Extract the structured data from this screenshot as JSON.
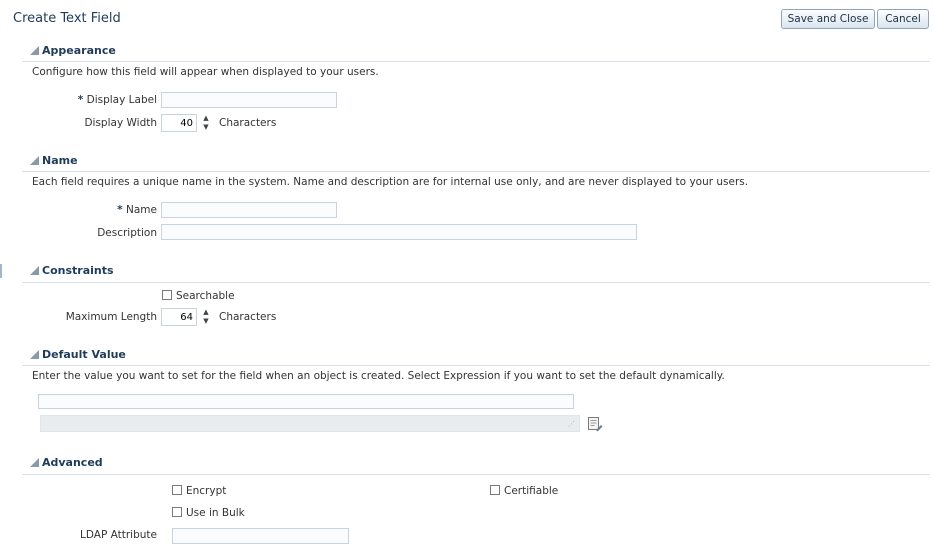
{
  "page": {
    "title": "Create Text Field",
    "save_close_label": "Save and Close",
    "cancel_label": "Cancel"
  },
  "appearance": {
    "title": "Appearance",
    "description": "Configure how this field will appear when displayed to your users.",
    "display_label": {
      "required_mark": "*",
      "label": "Display Label",
      "value": ""
    },
    "display_width": {
      "label": "Display Width",
      "value": "40",
      "unit": "Characters"
    }
  },
  "name_section": {
    "title": "Name",
    "description": "Each field requires a unique name in the system. Name and description are for internal use only, and are never displayed to your users.",
    "name": {
      "required_mark": "*",
      "label": "Name",
      "value": ""
    },
    "description_field": {
      "label": "Description",
      "value": ""
    }
  },
  "constraints": {
    "title": "Constraints",
    "searchable": {
      "label": "Searchable",
      "checked": false
    },
    "max_length": {
      "label": "Maximum Length",
      "value": "64",
      "unit": "Characters"
    }
  },
  "default_value": {
    "title": "Default Value",
    "description": "Enter the value you want to set for the field when an object is created. Select Expression if you want to set the default dynamically.",
    "value": "",
    "expression": ""
  },
  "advanced": {
    "title": "Advanced",
    "encrypt": {
      "label": "Encrypt",
      "checked": false
    },
    "certifiable": {
      "label": "Certifiable",
      "checked": false
    },
    "use_in_bulk": {
      "label": "Use in Bulk",
      "checked": false
    },
    "ldap_attribute": {
      "label": "LDAP Attribute",
      "value": ""
    }
  },
  "icons": {
    "collapse": "triangle-collapse-icon",
    "spinner_up": "spinner-up-icon",
    "spinner_down": "spinner-down-icon",
    "expression_editor": "expression-editor-icon",
    "resize_grip": "resize-grip-icon"
  },
  "colors": {
    "title_text": "#1f3b5a",
    "button_border": "#8fa5bd",
    "section_line": "#d9dfe6",
    "field_border": "#c8d3df"
  }
}
